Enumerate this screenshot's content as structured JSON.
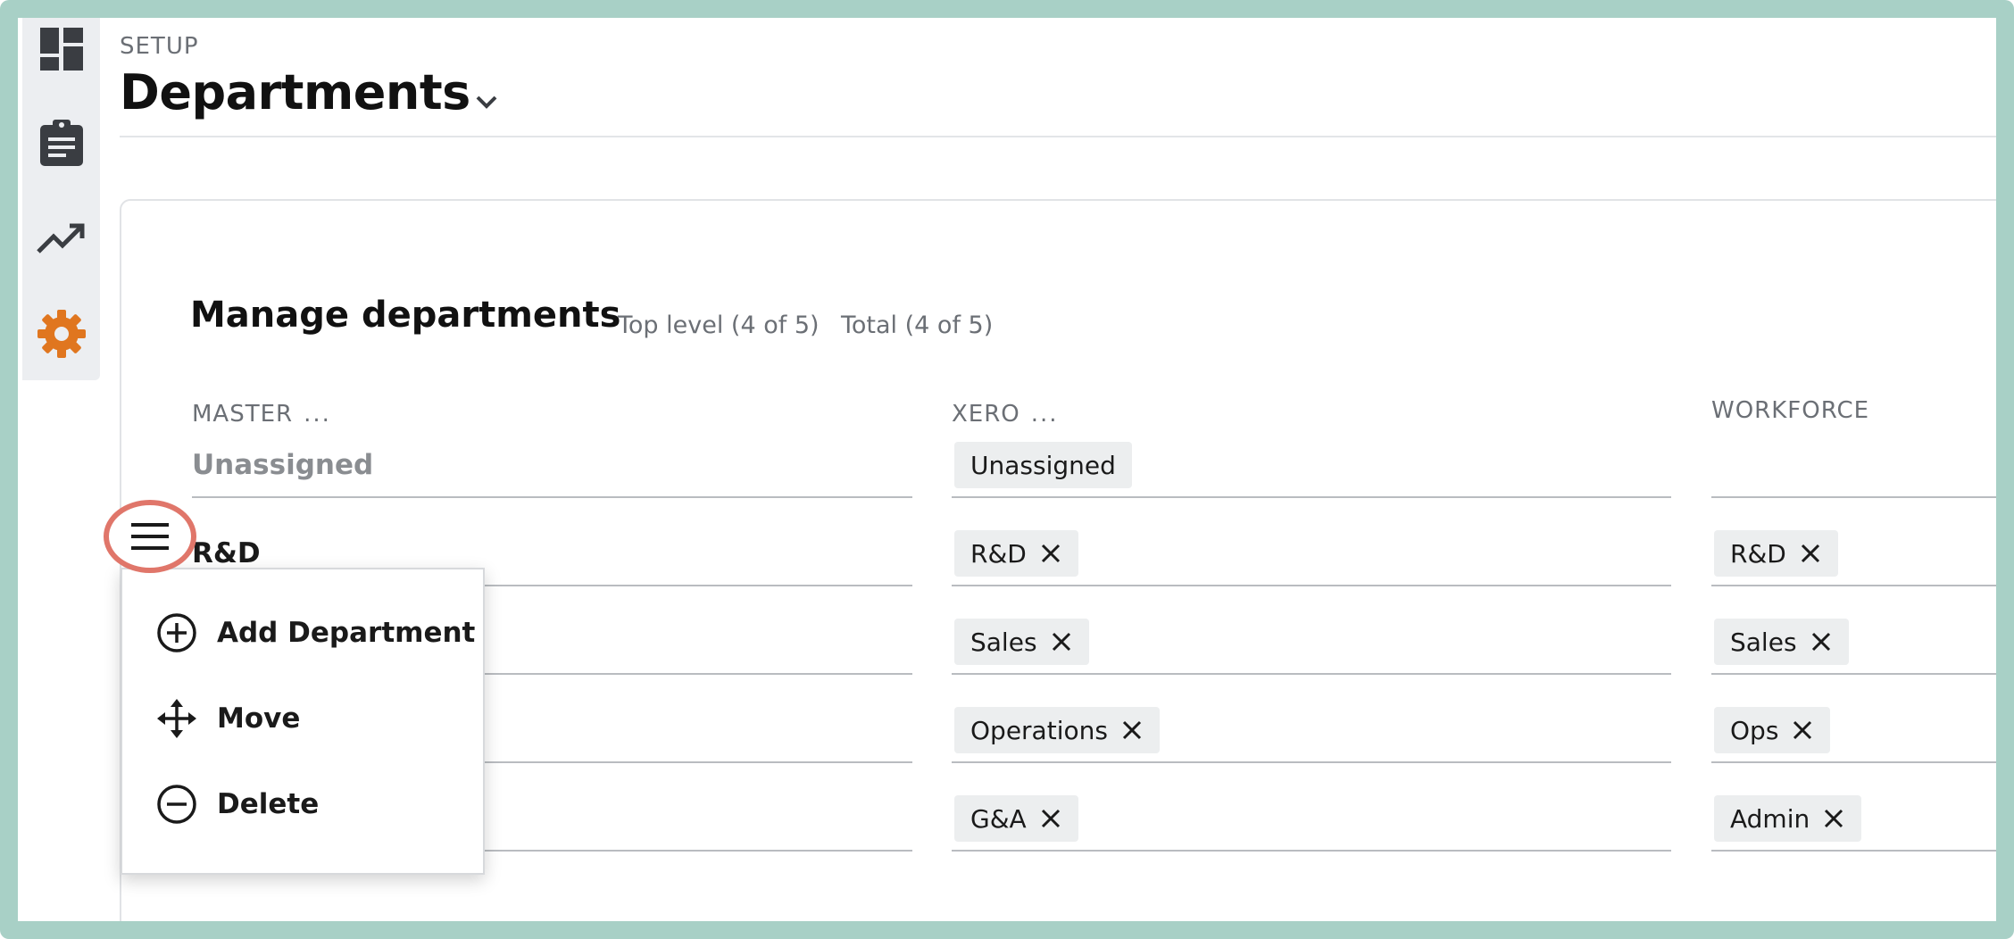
{
  "colors": {
    "frame": "#a8d0c6",
    "rail_bg": "#eceef1",
    "active_icon": "#e0761f",
    "highlight_ring": "#e0766a",
    "chip_bg": "#eceeef"
  },
  "rail": {
    "icons": [
      "dashboard-icon",
      "clipboard-icon",
      "trending-up-icon",
      "gear-icon"
    ],
    "active": "gear-icon"
  },
  "header": {
    "section": "SETUP",
    "title": "Departments"
  },
  "card": {
    "title": "Manage departments",
    "top_level": "Top level (4 of 5)",
    "total": "Total (4 of 5)",
    "columns": [
      {
        "label": "MASTER",
        "more": "..."
      },
      {
        "label": "XERO",
        "more": "..."
      },
      {
        "label": "WORKFORCE"
      }
    ],
    "rows": [
      {
        "master": "Unassigned",
        "xero": "Unassigned",
        "xero_removable": false,
        "workforce": ""
      },
      {
        "master": "R&D",
        "xero": "R&D",
        "xero_removable": true,
        "workforce": "R&D"
      },
      {
        "master": "",
        "xero": "Sales",
        "xero_removable": true,
        "workforce": "Sales"
      },
      {
        "master": "",
        "xero": "Operations",
        "xero_removable": true,
        "workforce": "Ops"
      },
      {
        "master": "",
        "xero": "G&A",
        "xero_removable": true,
        "workforce": "Admin"
      }
    ]
  },
  "row_menu": {
    "button_icon": "hamburger-menu-icon",
    "items": [
      {
        "label": "Add Department",
        "icon": "plus-circle-icon"
      },
      {
        "label": "Move",
        "icon": "move-arrows-icon"
      },
      {
        "label": "Delete",
        "icon": "minus-circle-icon"
      }
    ]
  }
}
